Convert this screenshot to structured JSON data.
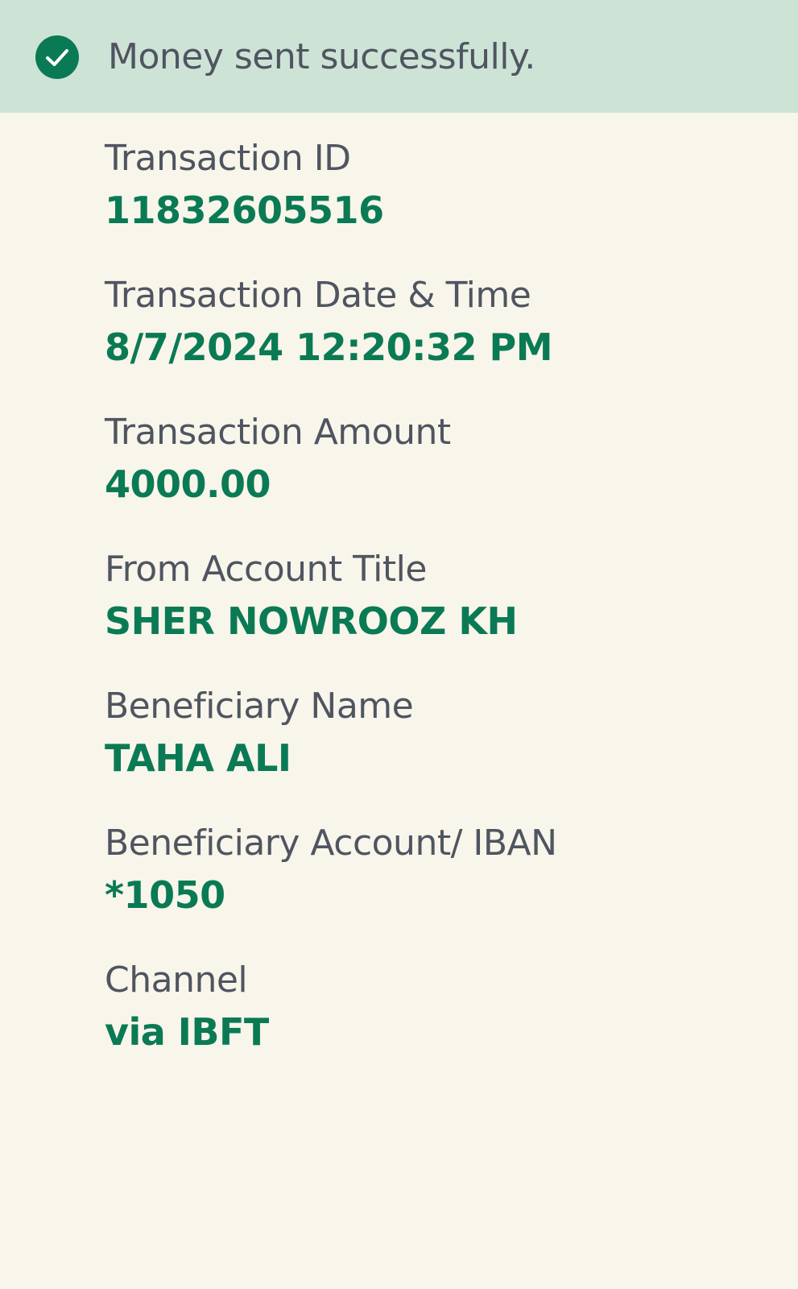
{
  "colors": {
    "page_background": "#f8f5ea",
    "banner_background": "#cde3d6",
    "success_green": "#0a7a55",
    "label_gray": "#4f5560"
  },
  "banner": {
    "icon": "check-circle-icon",
    "message": "Money sent successfully."
  },
  "fields": [
    {
      "label": "Transaction ID",
      "value": "11832605516"
    },
    {
      "label": "Transaction Date & Time",
      "value": "8/7/2024 12:20:32 PM"
    },
    {
      "label": "Transaction Amount",
      "value": "4000.00"
    },
    {
      "label": "From Account Title",
      "value": "SHER NOWROOZ KH"
    },
    {
      "label": "Beneficiary Name",
      "value": "TAHA ALI"
    },
    {
      "label": "Beneficiary Account/ IBAN",
      "value": "*1050"
    },
    {
      "label": "Channel",
      "value": "via IBFT"
    }
  ]
}
